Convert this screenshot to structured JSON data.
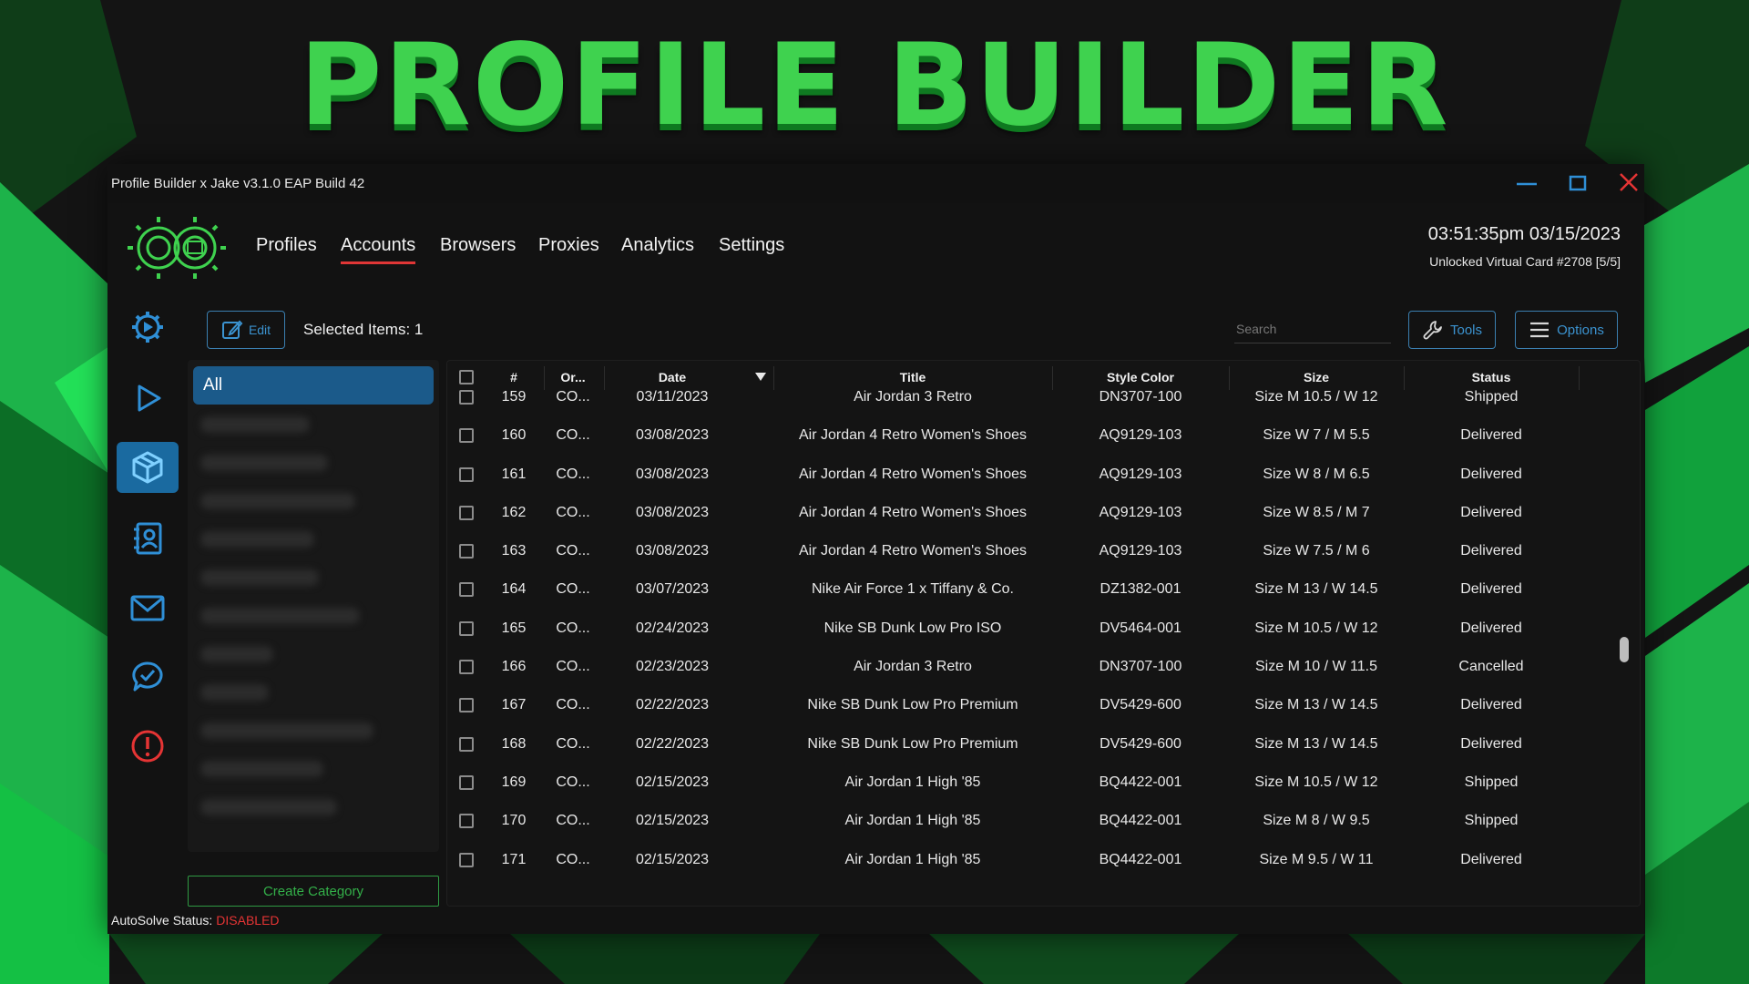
{
  "banner": {
    "title": "PROFILE BUILDER"
  },
  "window": {
    "title": "Profile Builder x Jake v3.1.0 EAP Build 42",
    "controls": {
      "minimize_icon": "minimize-icon",
      "maximize_icon": "maximize-icon",
      "close_icon": "close-icon"
    }
  },
  "nav": {
    "items": [
      "Profiles",
      "Accounts",
      "Browsers",
      "Proxies",
      "Analytics",
      "Settings"
    ],
    "active": "Accounts"
  },
  "header": {
    "clock": "03:51:35pm 03/15/2023",
    "unlock": "Unlocked Virtual Card #2708 [5/5]"
  },
  "sidebar": {
    "icons": [
      "gear-icon",
      "play-icon",
      "box-icon",
      "contacts-icon",
      "mail-icon",
      "chat-check-icon",
      "alert-icon"
    ],
    "active": "box-icon"
  },
  "toolbar": {
    "edit_label": "Edit",
    "selected_text": "Selected Items: 1",
    "search_placeholder": "Search",
    "tools_label": "Tools",
    "options_label": "Options"
  },
  "categories": {
    "all_label": "All",
    "create_label": "Create Category"
  },
  "status": {
    "autosolve_label": "AutoSolve Status:",
    "autosolve_value": "DISABLED"
  },
  "table": {
    "columns": [
      "#",
      "Or...",
      "Date",
      "Title",
      "Style Color",
      "Size",
      "Status"
    ],
    "rows": [
      {
        "num": "159",
        "order": "CO...",
        "date": "03/11/2023",
        "title": "Air Jordan 3 Retro",
        "style": "DN3707-100",
        "size": "Size M 10.5 / W 12",
        "status": "Shipped"
      },
      {
        "num": "160",
        "order": "CO...",
        "date": "03/08/2023",
        "title": "Air Jordan 4 Retro Women's Shoes",
        "style": "AQ9129-103",
        "size": "Size W 7 / M 5.5",
        "status": "Delivered"
      },
      {
        "num": "161",
        "order": "CO...",
        "date": "03/08/2023",
        "title": "Air Jordan 4 Retro Women's Shoes",
        "style": "AQ9129-103",
        "size": "Size W 8 / M 6.5",
        "status": "Delivered"
      },
      {
        "num": "162",
        "order": "CO...",
        "date": "03/08/2023",
        "title": "Air Jordan 4 Retro Women's Shoes",
        "style": "AQ9129-103",
        "size": "Size W 8.5 / M 7",
        "status": "Delivered"
      },
      {
        "num": "163",
        "order": "CO...",
        "date": "03/08/2023",
        "title": "Air Jordan 4 Retro Women's Shoes",
        "style": "AQ9129-103",
        "size": "Size W 7.5 / M 6",
        "status": "Delivered"
      },
      {
        "num": "164",
        "order": "CO...",
        "date": "03/07/2023",
        "title": "Nike Air Force 1 x Tiffany & Co.",
        "style": "DZ1382-001",
        "size": "Size M 13 / W 14.5",
        "status": "Delivered"
      },
      {
        "num": "165",
        "order": "CO...",
        "date": "02/24/2023",
        "title": "Nike SB Dunk Low Pro ISO",
        "style": "DV5464-001",
        "size": "Size M 10.5 / W 12",
        "status": "Delivered"
      },
      {
        "num": "166",
        "order": "CO...",
        "date": "02/23/2023",
        "title": "Air Jordan 3 Retro",
        "style": "DN3707-100",
        "size": "Size M 10 / W 11.5",
        "status": "Cancelled"
      },
      {
        "num": "167",
        "order": "CO...",
        "date": "02/22/2023",
        "title": "Nike SB Dunk Low Pro Premium",
        "style": "DV5429-600",
        "size": "Size M 13 / W 14.5",
        "status": "Delivered"
      },
      {
        "num": "168",
        "order": "CO...",
        "date": "02/22/2023",
        "title": "Nike SB Dunk Low Pro Premium",
        "style": "DV5429-600",
        "size": "Size M 13 / W 14.5",
        "status": "Delivered"
      },
      {
        "num": "169",
        "order": "CO...",
        "date": "02/15/2023",
        "title": "Air Jordan 1 High '85",
        "style": "BQ4422-001",
        "size": "Size M 10.5 / W 12",
        "status": "Shipped"
      },
      {
        "num": "170",
        "order": "CO...",
        "date": "02/15/2023",
        "title": "Air Jordan 1 High '85",
        "style": "BQ4422-001",
        "size": "Size M 8 / W 9.5",
        "status": "Shipped"
      },
      {
        "num": "171",
        "order": "CO...",
        "date": "02/15/2023",
        "title": "Air Jordan 1 High '85",
        "style": "BQ4422-001",
        "size": "Size M 9.5 / W 11",
        "status": "Delivered"
      }
    ]
  },
  "colors": {
    "brand_green": "#3fd24f",
    "accent_blue": "#1b5a8a",
    "alert_red": "#e53434"
  }
}
